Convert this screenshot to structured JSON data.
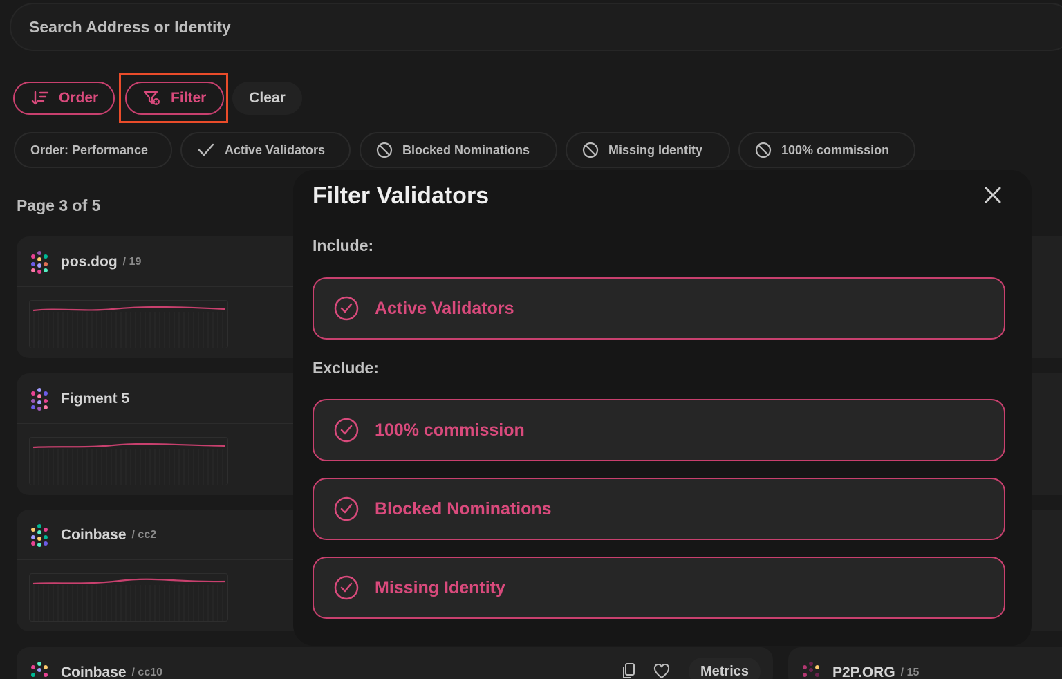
{
  "search": {
    "placeholder": "Search Address or Identity"
  },
  "toolbar": {
    "order_label": "Order",
    "filter_label": "Filter",
    "clear_label": "Clear"
  },
  "chips": [
    {
      "label": "Order: Performance",
      "icon": "none"
    },
    {
      "label": "Active Validators",
      "icon": "check-icon"
    },
    {
      "label": "Blocked Nominations",
      "icon": "block-icon"
    },
    {
      "label": "Missing Identity",
      "icon": "block-icon"
    },
    {
      "label": "100% commission",
      "icon": "block-icon"
    }
  ],
  "page_label": "Page 3 of 5",
  "validators": [
    {
      "name": "pos.dog",
      "sub": "/ 19"
    },
    {
      "name": "Figment 5",
      "sub": ""
    },
    {
      "name": "Coinbase",
      "sub": "/ cc2"
    },
    {
      "name": "Coinbase",
      "sub": "/ cc10"
    }
  ],
  "right_card": {
    "name": "P2P.ORG",
    "sub": "/ 15"
  },
  "metrics_label": "Metrics",
  "modal": {
    "title": "Filter Validators",
    "include_label": "Include:",
    "exclude_label": "Exclude:",
    "include_options": [
      "Active Validators"
    ],
    "exclude_options": [
      "100% commission",
      "Blocked Nominations",
      "Missing Identity"
    ]
  },
  "colors": {
    "accent": "#d94a7c",
    "background": "#1a1a1a",
    "modal": "#161616",
    "highlight": "#ea4c2a"
  }
}
